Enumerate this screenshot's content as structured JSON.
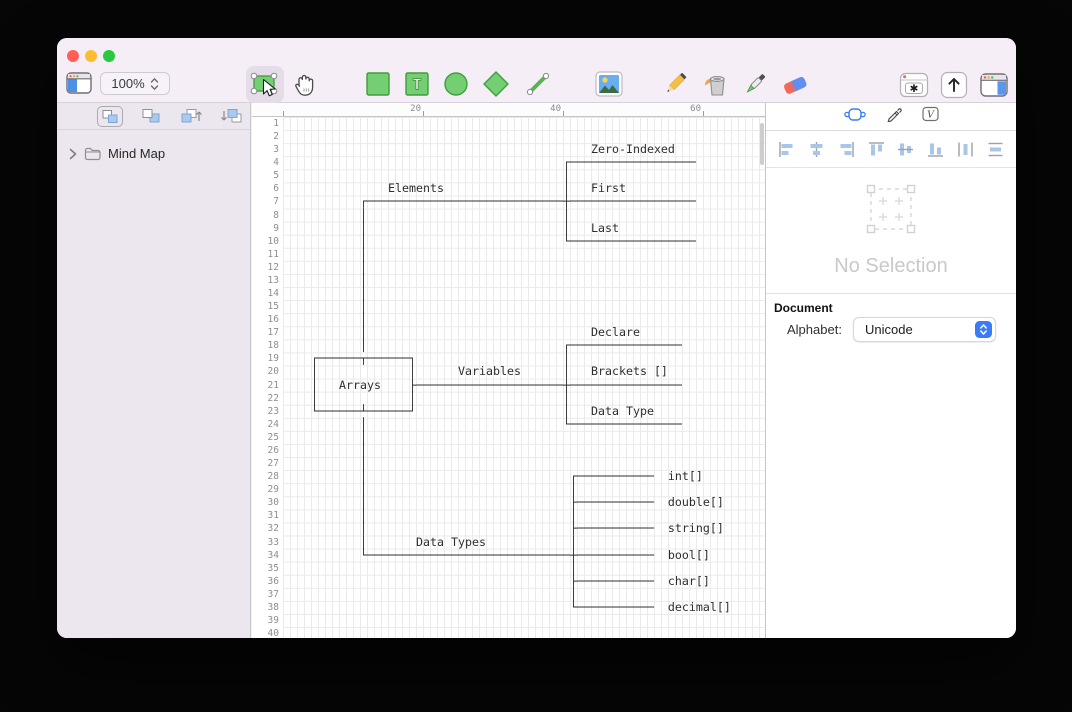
{
  "window": {
    "app": "Monodraw-style ASCII diagram editor",
    "traffic_lights": {
      "close": "#ff5f57",
      "minimize": "#febc2e",
      "zoom": "#28c840"
    }
  },
  "toolbar": {
    "zoom_value": "100%",
    "tools": [
      "toggle-left-sidebar",
      "zoom-level",
      "selection",
      "pan",
      "rectangle",
      "text",
      "ellipse",
      "diamond",
      "line",
      "image",
      "pencil",
      "fill",
      "eyedropper",
      "eraser",
      "character-picker",
      "share",
      "toggle-right-sidebar"
    ]
  },
  "sidebar": {
    "layer_actions": [
      "group-objects",
      "overlap-objects",
      "bring-forward",
      "send-backward"
    ],
    "tree_item": "Mind Map"
  },
  "canvas": {
    "ruler_ticks": [
      {
        "label": "20",
        "col": 20
      },
      {
        "label": "40",
        "col": 40
      },
      {
        "label": "60",
        "col": 60
      }
    ],
    "row_count": 40,
    "grid_cell": {
      "width": 7,
      "height": 13.083
    },
    "ascii_rows": [
      "",
      "",
      "                                            Zero-Indexed",
      "                                        ┌──────────────────",
      "                                        │",
      "               Elements                 │   First",
      "           ┌────────────────────────────┼──────────────────",
      "           │                            │",
      "           │                            │   Last",
      "           │                            └──────────────────",
      "           │",
      "           │",
      "           │",
      "           │",
      "           │",
      "           │",
      "           │                                Declare",
      "           │                            ┌────────────────",
      "    ┌──────┬──────┐                     │",
      "    │             │      Variables      │   Brackets []",
      "    │   Arrays    ├─────────────────────┼────────────────",
      "    │             │                     │",
      "    └──────┴──────┘                     │   Data Type",
      "           │                            └────────────────",
      "           │",
      "           │",
      "           │",
      "           │                             ┌───────────  int[]",
      "           │                             │",
      "           │                             ├───────────  double[]",
      "           │                             │",
      "           │                             ├───────────  string[]",
      "           │       Data Types            │",
      "           └─────────────────────────────┼───────────  bool[]",
      "                                         │",
      "                                         ├───────────  char[]",
      "                                         │",
      "                                         └───────────  decimal[]",
      "",
      ""
    ]
  },
  "diagram": {
    "root": "Arrays",
    "branches": [
      {
        "label": "Elements",
        "children": [
          "Zero-Indexed",
          "First",
          "Last"
        ]
      },
      {
        "label": "Variables",
        "children": [
          "Declare",
          "Brackets []",
          "Data Type"
        ]
      },
      {
        "label": "Data Types",
        "children": [
          "int[]",
          "double[]",
          "string[]",
          "bool[]",
          "char[]",
          "decimal[]"
        ]
      }
    ]
  },
  "inspector": {
    "tabs": [
      "shape-inspector",
      "style-inspector",
      "variables-inspector"
    ],
    "align_tools": [
      "align-left",
      "align-center-horizontal",
      "align-right",
      "align-top",
      "align-center-vertical",
      "align-bottom",
      "distribute-horizontal",
      "distribute-vertical"
    ],
    "empty_state": "No Selection",
    "document": {
      "section_title": "Document",
      "alphabet_label": "Alphabet:",
      "alphabet_value": "Unicode"
    }
  },
  "colors": {
    "chrome": "#f5eef7",
    "sidebar": "#ece7ee",
    "accent_blue": "#3b7cf6",
    "shape_green_fill": "#74cf72",
    "shape_green_stroke": "#3f9e3d",
    "grid_line": "#eaeaea",
    "diagram_ink": "#2d2d2d"
  }
}
